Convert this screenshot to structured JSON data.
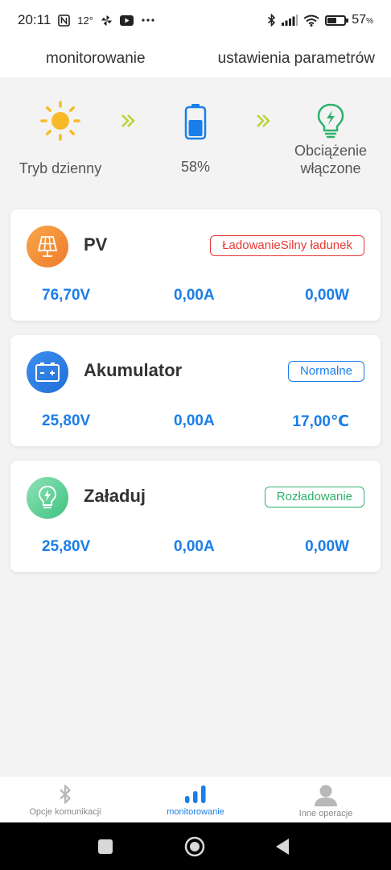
{
  "status_bar": {
    "time": "20:11",
    "temperature": "12°",
    "icons": [
      "nfc-icon",
      "temperature-text",
      "pinwheel-icon",
      "youtube-icon",
      "more-dots-icon",
      "bluetooth-icon",
      "signal-icon",
      "wifi-icon",
      "battery-icon"
    ],
    "battery_level": 0.57,
    "battery_text": "57",
    "battery_unit": "%"
  },
  "top_tabs": {
    "monitoring": "monitorowanie",
    "settings": "ustawienia parametrów"
  },
  "flow": {
    "sun_label": "Tryb dzienny",
    "battery_label": "58%",
    "battery_level": 0.58,
    "load_label_line1": "Obciążenie",
    "load_label_line2": "włączone"
  },
  "cards": {
    "pv": {
      "title": "PV",
      "badge": "ŁadowanieSilny ładunek",
      "voltage": "76,70V",
      "current": "0,00A",
      "power": "0,00W"
    },
    "battery": {
      "title": "Akumulator",
      "badge": "Normalne",
      "voltage": "25,80V",
      "current": "0,00A",
      "temperature": "17,00℃"
    },
    "load": {
      "title": "Załaduj",
      "badge": "Rozładowanie",
      "voltage": "25,80V",
      "current": "0,00A",
      "power": "0,00W"
    }
  },
  "colors": {
    "accent_blue": "#1a7ee8",
    "badge_red": "#e53935",
    "badge_green": "#2eb26b",
    "sun_yellow": "#f7b928",
    "chevron_yellow_green": "#b8d432"
  },
  "bottom_nav": {
    "comm": "Opcje komunikacji",
    "monitor": "monitorowanie",
    "other": "Inne operacje"
  }
}
